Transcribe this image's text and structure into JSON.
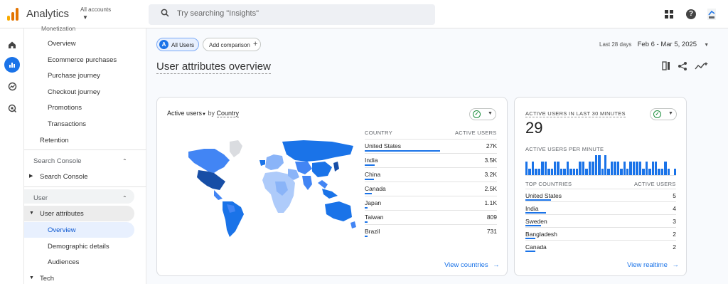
{
  "app": {
    "title": "Analytics",
    "account_label": "All accounts"
  },
  "search": {
    "placeholder": "Try searching \"Insights\""
  },
  "colors": {
    "accent": "#1a73e8",
    "logo": [
      "#f9ab00",
      "#e37400",
      "#e37400"
    ]
  },
  "rail": {
    "icons": [
      "home-icon",
      "reports-icon",
      "explore-icon",
      "advertising-icon"
    ]
  },
  "sidenav": {
    "truncated_section": "Monetization",
    "items": [
      "Overview",
      "Ecommerce purchases",
      "Purchase journey",
      "Checkout journey",
      "Promotions",
      "Transactions"
    ],
    "retention": "Retention",
    "search_console_section": "Search Console",
    "search_console_item": "Search Console",
    "user_section": "User",
    "user_attributes": "User attributes",
    "user_items": [
      "Overview",
      "Demographic details",
      "Audiences"
    ],
    "tech": "Tech"
  },
  "toolbar": {
    "all_users_badge": "A",
    "all_users": "All Users",
    "add_comparison": "Add comparison",
    "date_label": "Last 28 days",
    "date_range": "Feb 6 - Mar 5, 2025"
  },
  "page": {
    "title": "User attributes overview"
  },
  "country_card": {
    "metric": "Active users",
    "by_label": "by",
    "dimension": "Country",
    "col_country": "COUNTRY",
    "col_users": "ACTIVE USERS",
    "rows": [
      {
        "name": "United States",
        "value": "27K",
        "share": 1.0
      },
      {
        "name": "India",
        "value": "3.5K",
        "share": 0.13
      },
      {
        "name": "China",
        "value": "3.2K",
        "share": 0.12
      },
      {
        "name": "Canada",
        "value": "2.5K",
        "share": 0.09
      },
      {
        "name": "Japan",
        "value": "1.1K",
        "share": 0.04
      },
      {
        "name": "Taiwan",
        "value": "809",
        "share": 0.03
      },
      {
        "name": "Brazil",
        "value": "731",
        "share": 0.027
      }
    ],
    "link": "View countries"
  },
  "realtime_card": {
    "title": "ACTIVE USERS IN LAST 30 MINUTES",
    "count": "29",
    "per_minute_label": "ACTIVE USERS PER MINUTE",
    "per_minute": [
      2,
      1,
      2,
      1,
      1,
      2,
      2,
      1,
      1,
      2,
      2,
      1,
      1,
      2,
      1,
      1,
      1,
      2,
      2,
      1,
      2,
      2,
      3,
      3,
      1,
      3,
      1,
      2,
      2,
      2,
      1,
      2,
      1,
      2,
      2,
      2,
      2,
      1,
      2,
      1,
      2,
      2,
      1,
      1,
      2,
      1,
      0,
      1
    ],
    "col_country": "TOP COUNTRIES",
    "col_users": "ACTIVE USERS",
    "rows": [
      {
        "name": "United States",
        "value": "5",
        "share": 1.0
      },
      {
        "name": "India",
        "value": "4",
        "share": 0.8
      },
      {
        "name": "Sweden",
        "value": "3",
        "share": 0.6
      },
      {
        "name": "Bangladesh",
        "value": "2",
        "share": 0.4
      },
      {
        "name": "Canada",
        "value": "2",
        "share": 0.4
      }
    ],
    "link": "View realtime"
  }
}
